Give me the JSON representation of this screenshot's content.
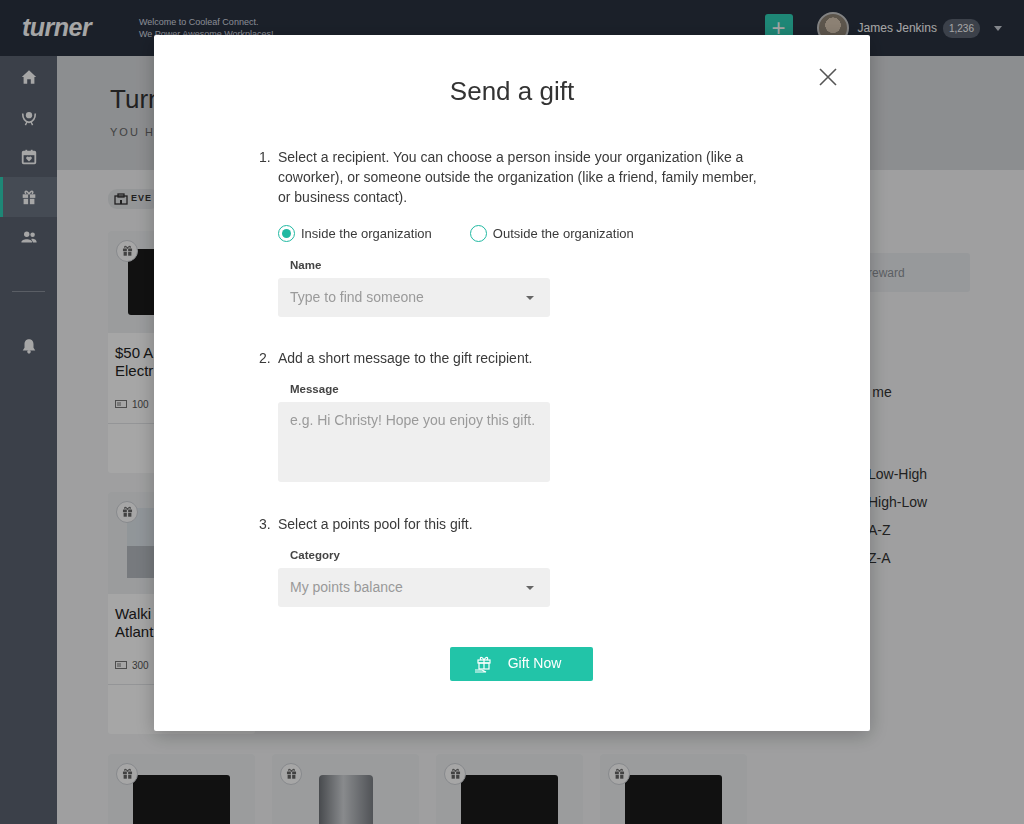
{
  "app": {
    "logo": "turner",
    "tagline": [
      "Welcome to Cooleaf Connect.",
      "We Power Awesome Workplaces!"
    ],
    "add_button": "+",
    "user": {
      "name": "James Jenkins",
      "points": "1,236"
    }
  },
  "sidebar": {
    "items": [
      {
        "selected": false
      },
      {
        "selected": false
      },
      {
        "selected": false
      },
      {
        "selected": true
      },
      {
        "selected": false
      }
    ],
    "bottom_items": [
      {
        "selected": false
      }
    ]
  },
  "page": {
    "title": "Turn",
    "subtitle": "YOU H",
    "filter_chip": "EVE"
  },
  "rewards": [
    {
      "title_lines": [
        "$50 A",
        "Electr"
      ],
      "points": "100"
    },
    {
      "title_lines": [
        "Walki",
        "Atlant"
      ],
      "points": "300"
    }
  ],
  "bottom_rewards": [
    {
      "kind": "gift-card"
    },
    {
      "kind": "mug"
    },
    {
      "kind": "gift-card"
    },
    {
      "kind": "gift-card"
    }
  ],
  "side_panel": {
    "search_placeholder": "reward",
    "filter_label": "or me",
    "sort_options": [
      "Low-High",
      "High-Low",
      "A-Z",
      "Z-A"
    ]
  },
  "modal": {
    "title": "Send a gift",
    "steps": [
      {
        "number": "1.",
        "text": "Select a recipient. You can choose a person inside your organization (like a coworker), or someone outside the organization (like a friend, family member, or business contact)."
      },
      {
        "number": "2.",
        "text": "Add a short message to the gift recipient."
      },
      {
        "number": "3.",
        "text": "Select a points pool for this gift."
      }
    ],
    "recipient_options": [
      {
        "label": "Inside the organization",
        "selected": true
      },
      {
        "label": "Outside the organization",
        "selected": false
      }
    ],
    "name_field": {
      "label": "Name",
      "placeholder": "Type to find someone"
    },
    "message_field": {
      "label": "Message",
      "placeholder": "e.g. Hi Christy! Hope you enjoy this gift."
    },
    "category_field": {
      "label": "Category",
      "value": "My points balance"
    },
    "submit": "Gift Now"
  }
}
